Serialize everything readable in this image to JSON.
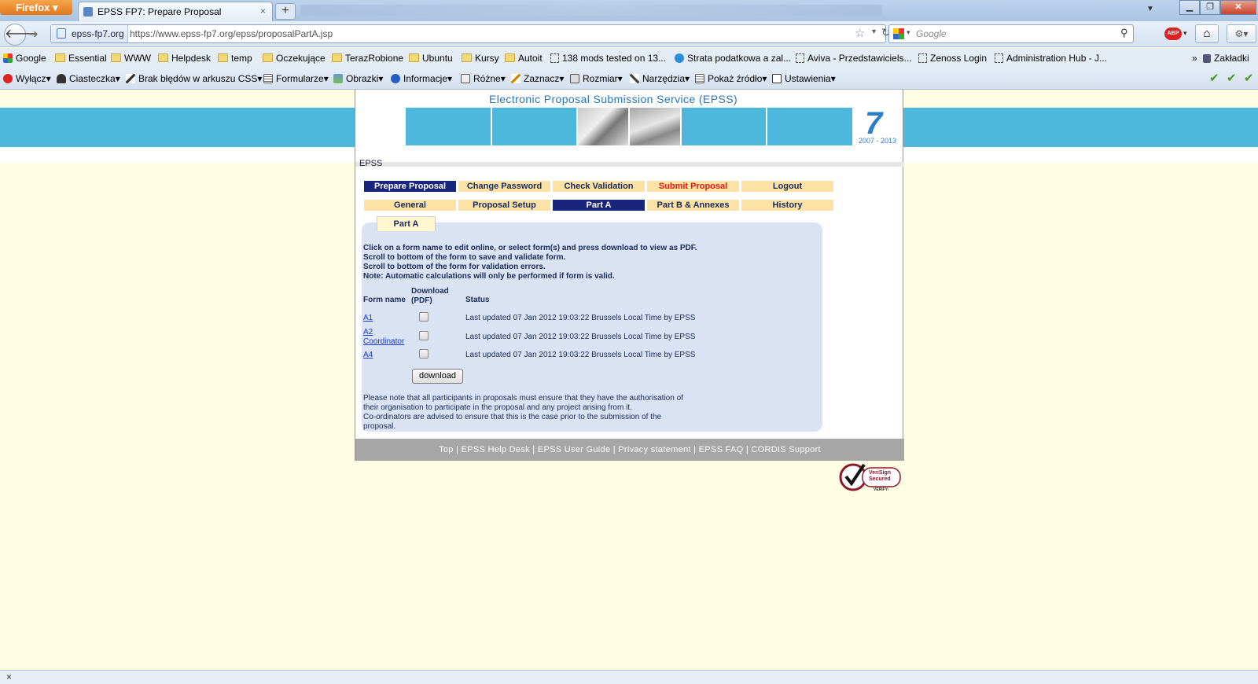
{
  "browser": {
    "app_button": "Firefox",
    "tab_title": "EPSS FP7: Prepare Proposal",
    "new_tab": "+",
    "identity": "epss-fp7.org",
    "url": "https://www.epss-fp7.org/epss/proposalPartA.jsp",
    "search_placeholder": "Google",
    "bookmarks": [
      "Google",
      "Essential",
      "WWW",
      "Helpdesk",
      "temp",
      "Oczekujące",
      "TerazRobione",
      "Ubuntu",
      "Kursy",
      "Autoit",
      "138 mods tested on 13...",
      "Strata podatkowa a zal...",
      "Aviva - Przedstawiciels...",
      "Zenoss Login",
      "Administration Hub - J..."
    ],
    "bookmarks_more": "»",
    "bookmarks_menu": "Zakładki",
    "devtools": [
      "Wyłącz",
      "Ciasteczka",
      "Brak błędów w arkuszu CSS",
      "Formularze",
      "Obrazki",
      "Informacje",
      "Różne",
      "Zaznacz",
      "Rozmiar",
      "Narzędzia",
      "Pokaż źródło",
      "Ustawienia"
    ]
  },
  "header": {
    "title": "Electronic Proposal Submission Service  (EPSS)",
    "logo_years": "2007 - 2013",
    "breadcrumb": "EPSS"
  },
  "menu_main": [
    "Prepare Proposal",
    "Change Password",
    "Check Validation",
    "Submit Proposal",
    "Logout"
  ],
  "menu_sub": [
    "General",
    "Proposal Setup",
    "Part A",
    "Part B & Annexes",
    "History"
  ],
  "panel": {
    "tab": "Part A",
    "instructions": [
      "Click on a form name to edit online, or select form(s) and press download to view as PDF.",
      "Scroll to bottom of the form to save and validate form.",
      "Scroll to bottom of the form for validation errors.",
      "Note: Automatic calculations will only be performed if form is valid."
    ],
    "col_form": "Form name",
    "col_download_1": "Download",
    "col_download_2": "(PDF)",
    "col_status": "Status",
    "rows": [
      {
        "name": "A1",
        "name2": "",
        "status": "Last updated 07 Jan 2012 19:03:22 Brussels Local Time by EPSS"
      },
      {
        "name": "A2",
        "name2": "Coordinator",
        "status": "Last updated 07 Jan 2012 19:03:22 Brussels Local Time by EPSS"
      },
      {
        "name": "A4",
        "name2": "",
        "status": "Last updated 07 Jan 2012 19:03:22 Brussels Local Time by EPSS"
      }
    ],
    "download_button": "download",
    "notice": [
      "Please note that all participants in proposals must ensure that they have the authorisation of",
      "their organisation to participate in the proposal and any project arising from it.",
      "Co-ordinators are advised to ensure that this is the case prior to the submission of the",
      "proposal."
    ]
  },
  "footer_links": [
    "Top",
    "EPSS Help Desk",
    "EPSS User Guide",
    "Privacy statement",
    "EPSS FAQ",
    "CORDIS Support"
  ],
  "footer_sep": " | ",
  "verisign": {
    "line1": "VeriSign",
    "line2": "Secured",
    "line3": "VERIFY›"
  },
  "statusbar_close": "×"
}
